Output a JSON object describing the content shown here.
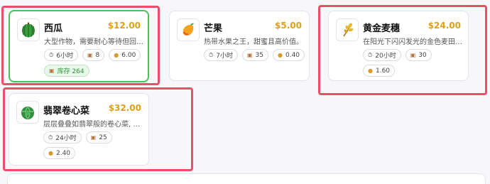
{
  "cards": [
    {
      "name": "西瓜",
      "price": "$12.00",
      "desc": "大型作物，需要耐心等待但回报…",
      "time": "6小时",
      "seeds": "8",
      "value": "6.00",
      "stock": "库存 264",
      "icon": "watermelon-icon"
    },
    {
      "name": "芒果",
      "price": "$5.00",
      "desc": "热带水果之王，甜蜜且高价值。",
      "time": "7小时",
      "seeds": "35",
      "value": "0.40",
      "icon": "mango-icon"
    },
    {
      "name": "黄金麦穗",
      "price": "$24.00",
      "desc": "在阳光下闪闪发光的金色麦田,…",
      "time": "20小时",
      "seeds": "30",
      "value": "1.60",
      "icon": "wheat-icon"
    },
    {
      "name": "翡翠卷心菜",
      "price": "$32.00",
      "desc": "层层叠叠如翡翠般的卷心菜, 需…",
      "time": "24小时",
      "seeds": "25",
      "value": "2.40",
      "icon": "cabbage-icon"
    }
  ],
  "colors": {
    "price": "#e0a012",
    "highlight": "#e8506a",
    "selected": "#4cc05a"
  }
}
